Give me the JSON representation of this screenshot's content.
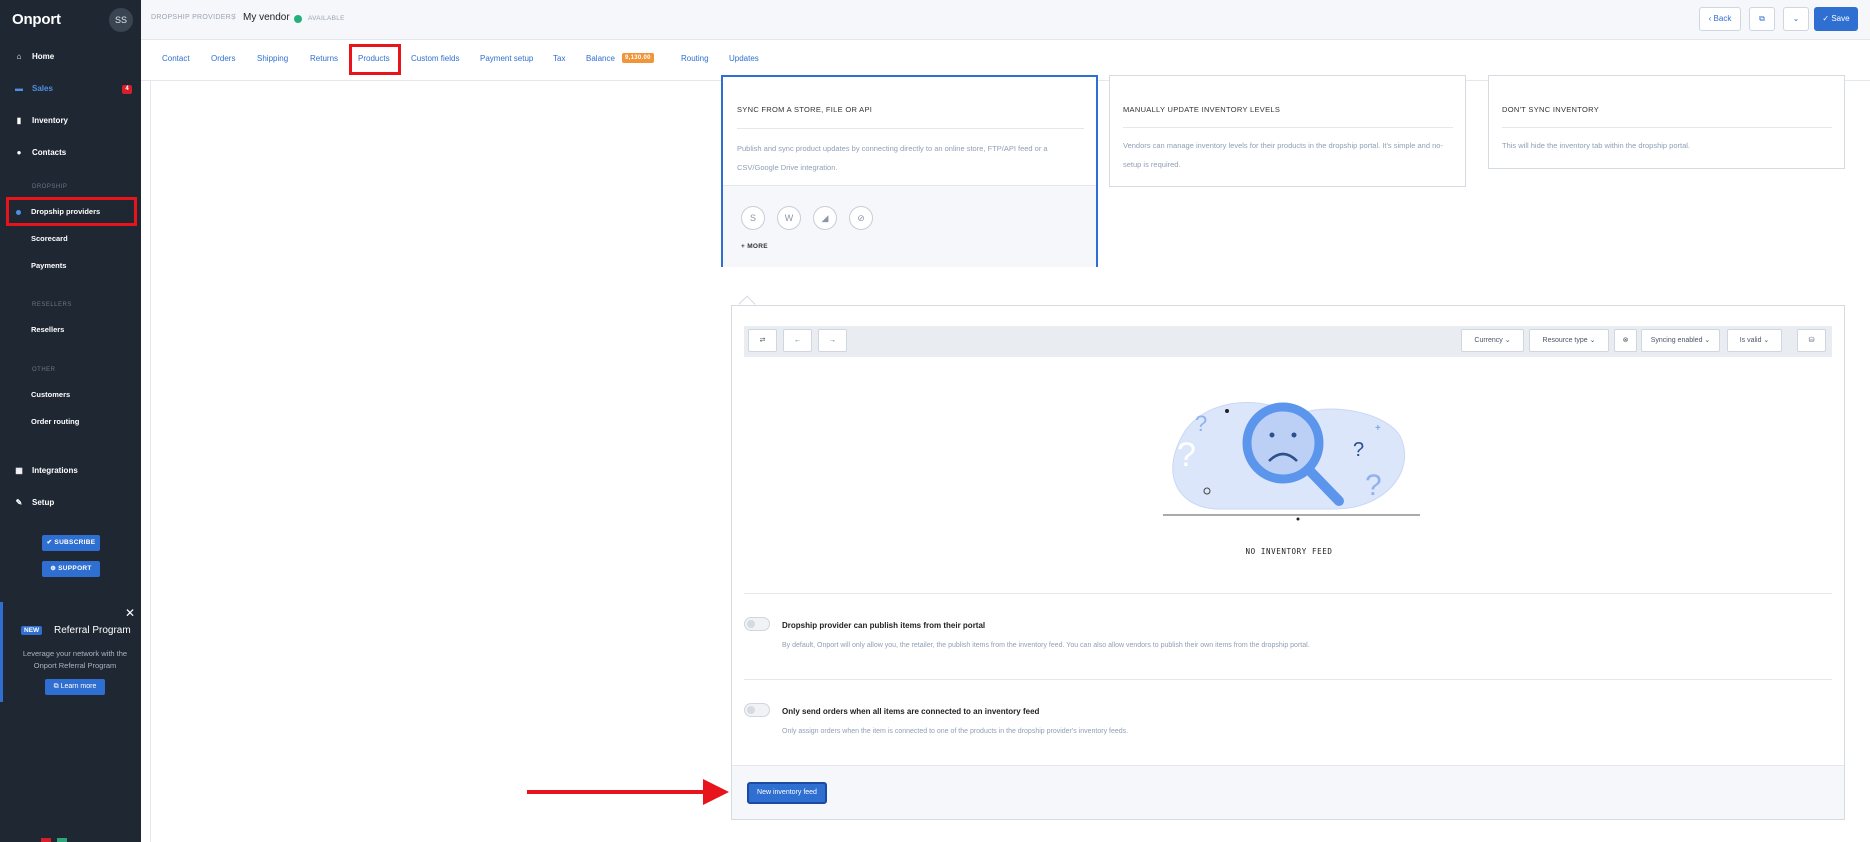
{
  "app": {
    "logo": "Onport",
    "avatar": "SS"
  },
  "sidebar": {
    "nav": [
      {
        "label": "Home",
        "icon": "home-icon",
        "glyph": "⌂"
      },
      {
        "label": "Sales",
        "icon": "cart-icon",
        "glyph": "🛒",
        "badge": "4"
      },
      {
        "label": "Inventory",
        "icon": "bookmark-icon",
        "glyph": "▮"
      },
      {
        "label": "Contacts",
        "icon": "person-icon",
        "glyph": "●"
      }
    ],
    "sections": {
      "dropship": "DROPSHIP",
      "resellers": "RESELLERS",
      "other": "OTHER"
    },
    "dropship_items": [
      "Dropship providers",
      "Scorecard",
      "Payments"
    ],
    "reseller_items": [
      "Resellers"
    ],
    "other_items": [
      "Customers",
      "Order routing"
    ],
    "bottom_nav": [
      {
        "label": "Integrations",
        "icon": "grid-icon",
        "glyph": "▦"
      },
      {
        "label": "Setup",
        "icon": "wrench-icon",
        "glyph": "✎"
      }
    ],
    "subscribe_label": "✔ SUBSCRIBE",
    "support_label": "⊕ SUPPORT",
    "referral": {
      "badge": "NEW",
      "title": "Referral Program",
      "desc": "Leverage your network with the Onport Referral Program",
      "button": "⧉ Learn more",
      "close": "✕"
    }
  },
  "header": {
    "breadcrumb": "DROPSHIP PROVIDERS",
    "separator": "/",
    "vendor": "My vendor",
    "status": "AVAILABLE",
    "back_label": "‹ Back",
    "link_icon": "⧉",
    "chevron": "⌄",
    "save_label": "✓ Save"
  },
  "tabs": [
    "Contact",
    "Orders",
    "Shipping",
    "Returns",
    "Products",
    "Custom fields",
    "Payment setup",
    "Tax",
    "Balance",
    "Routing",
    "Updates"
  ],
  "balance_badge": "9,130.00",
  "cards": [
    {
      "title": "SYNC FROM A STORE, FILE OR API",
      "desc": "Publish and sync product updates by connecting directly to an online store, FTP/API feed or a CSV/Google Drive integration.",
      "more": "+ MORE"
    },
    {
      "title": "MANUALLY UPDATE INVENTORY LEVELS",
      "desc": "Vendors can manage inventory levels for their products in the dropship portal. It's simple and no-setup is required."
    },
    {
      "title": "DON'T SYNC INVENTORY",
      "desc": "This will hide the inventory tab within the dropship portal."
    }
  ],
  "integration_icons": [
    {
      "name": "shopify-icon",
      "glyph": "S"
    },
    {
      "name": "woocommerce-icon",
      "glyph": "W"
    },
    {
      "name": "bigcommerce-icon",
      "glyph": "◢"
    },
    {
      "name": "squarespace-icon",
      "glyph": "⊘"
    }
  ],
  "toolbar": {
    "swap": "⇄",
    "prev": "←",
    "next": "→",
    "filters": [
      "Currency ⌄",
      "Resource type ⌄",
      "Syncing enabled ⌄",
      "Is valid ⌄"
    ],
    "clear": "⊗",
    "db": "⛁"
  },
  "empty_state": "NO INVENTORY FEED",
  "options": [
    {
      "title": "Dropship provider can publish items from their portal",
      "desc": "By default, Onport will only allow you, the retailer, the publish items from the inventory feed. You can also allow vendors to publish their own items from the dropship portal."
    },
    {
      "title": "Only send orders when all items are connected to an inventory feed",
      "desc": "Only assign orders when the item is connected to one of the products in the dropship provider's inventory feeds."
    }
  ],
  "new_feed_label": "New inventory feed",
  "colors": {
    "accent": "#2f6fd1",
    "sidebar": "#1f2733",
    "highlight": "#e8141c",
    "badge": "#f0953a"
  }
}
